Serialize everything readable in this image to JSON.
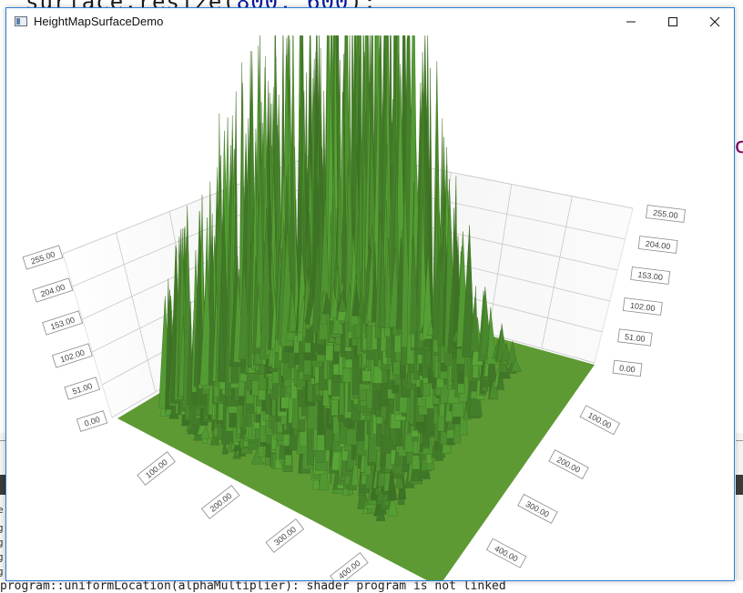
{
  "background": {
    "code_line_text": "surface.resize(",
    "code_line_args": "800, 600",
    "code_line_end": ");",
    "right_fragment": "c",
    "console_line": "program::uniformLocation(alphaMultiplier): shader program is not linked",
    "left_glyphs": [
      "e",
      "g",
      "g",
      "g",
      "g"
    ]
  },
  "window": {
    "title": "HeightMapSurfaceDemo",
    "controls": {
      "minimize": "minimize",
      "maximize": "maximize",
      "close": "close"
    }
  },
  "chart_data": {
    "type": "surface",
    "title": "",
    "surface_color": "#5e9a34",
    "grid": true,
    "y_axis": {
      "ticks": [
        "0.00",
        "51.00",
        "102.00",
        "153.00",
        "204.00",
        "255.00"
      ],
      "range": [
        0,
        255
      ]
    },
    "x_axis": {
      "ticks": [
        "100.00",
        "200.00",
        "300.00",
        "400.00"
      ]
    },
    "z_axis": {
      "ticks": [
        "100.00",
        "200.00",
        "300.00",
        "400.00"
      ]
    }
  }
}
